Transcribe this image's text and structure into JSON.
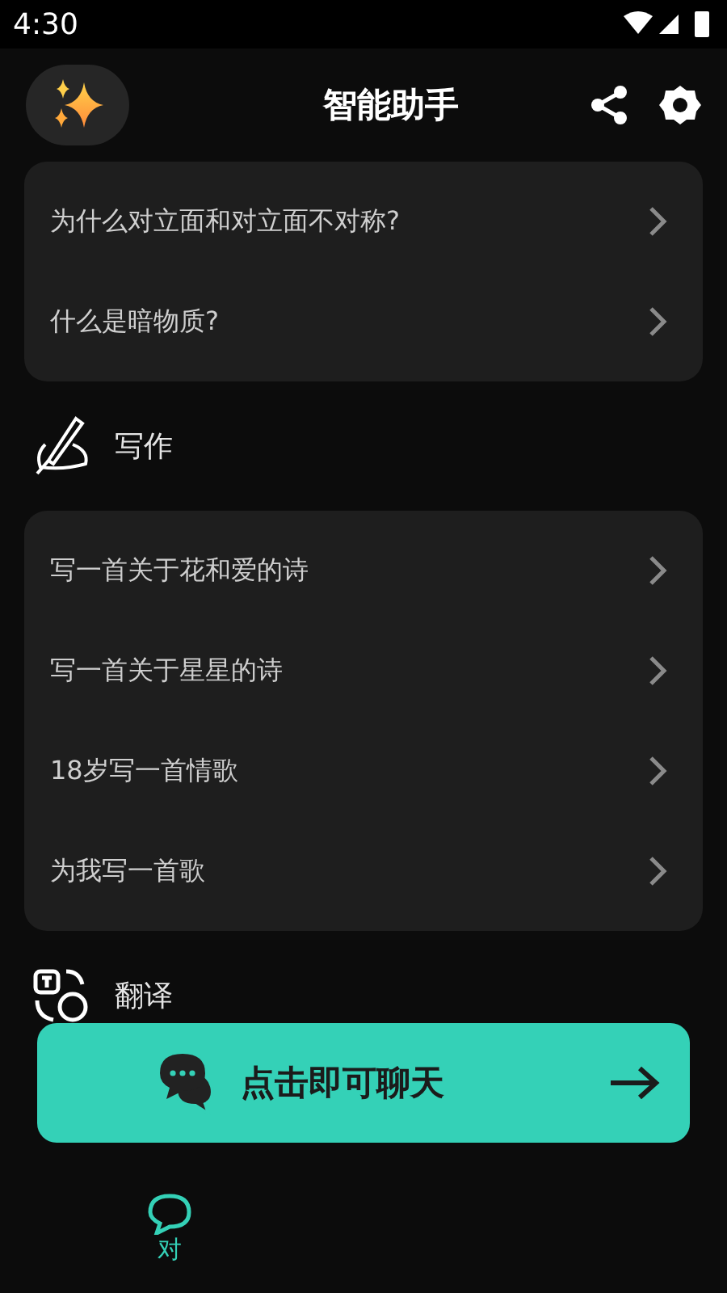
{
  "status_bar": {
    "time": "4:30"
  },
  "header": {
    "title": "智能助手"
  },
  "sections": [
    {
      "items": [
        "为什么对立面和对立面不对称?",
        "什么是暗物质?"
      ]
    },
    {
      "kind": "writing",
      "title": "写作",
      "items": [
        "写一首关于花和爱的诗",
        "写一首关于星星的诗",
        "18岁写一首情歌",
        "为我写一首歌"
      ]
    },
    {
      "kind": "translation",
      "title": "翻译"
    }
  ],
  "chat_button": {
    "label": "点击即可聊天"
  },
  "bottom_nav": [
    {
      "label": "对",
      "selected": true
    }
  ]
}
